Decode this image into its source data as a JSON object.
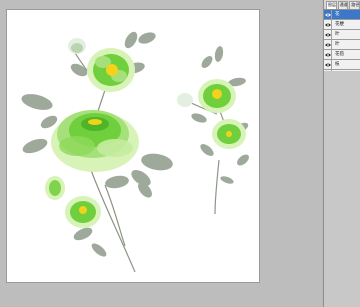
{
  "panel": {
    "tabs": [
      {
        "label": "图层"
      },
      {
        "label": "通道"
      },
      {
        "label": "路径"
      }
    ],
    "layers": [
      {
        "name": "花",
        "icon": "eye-icon",
        "selected": true
      },
      {
        "name": "花梗",
        "icon": "eye-icon",
        "selected": false
      },
      {
        "name": "叶",
        "icon": "eye-icon",
        "selected": false
      },
      {
        "name": "叶",
        "icon": "eye-icon",
        "selected": false
      },
      {
        "name": "花苞",
        "icon": "eye-icon",
        "selected": false
      },
      {
        "name": "枝",
        "icon": "eye-icon",
        "selected": false
      },
      {
        "name": "背景",
        "icon": "eye-icon",
        "selected": false
      }
    ]
  },
  "colors": {
    "workspace": "#bdbdbd",
    "panel": "#c8c8c8",
    "selection": "#3d78c8",
    "petal": "#6fcf3c",
    "petal_light": "#d8f3b8",
    "leaf": "#8e9b8a",
    "stamen": "#f2d21b"
  }
}
